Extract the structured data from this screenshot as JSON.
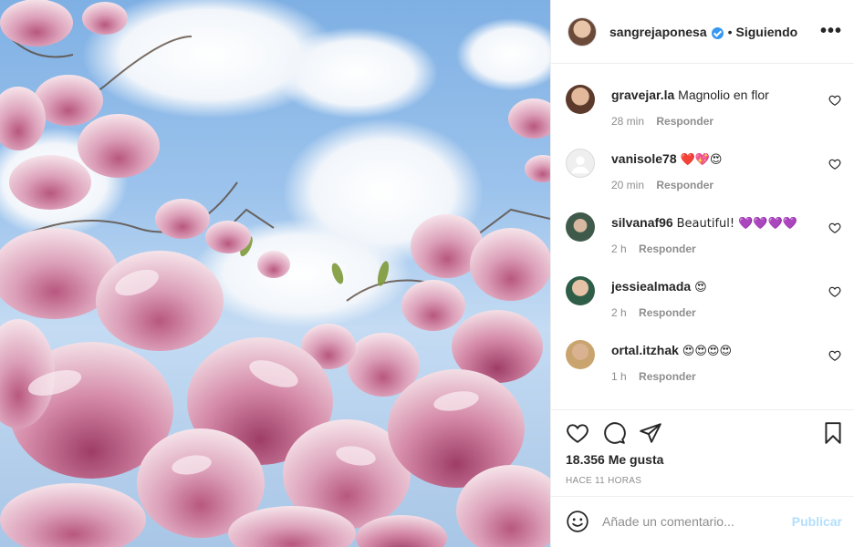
{
  "post": {
    "owner": "sangrejaponesa",
    "follow_status": "Siguiendo",
    "separator": "•",
    "more_label": "•••"
  },
  "comments": [
    {
      "user": "gravejar.la",
      "text": "Magnolio en flor",
      "time": "28 min",
      "reply": "Responder"
    },
    {
      "user": "vanisole78",
      "text": "❤️💖😍",
      "time": "20 min",
      "reply": "Responder"
    },
    {
      "user": "silvanaf96",
      "text": "Beautiful! 💜💜💜💜",
      "time": "2 h",
      "reply": "Responder"
    },
    {
      "user": "jessiealmada",
      "text": "😍",
      "time": "2 h",
      "reply": "Responder"
    },
    {
      "user": "ortal.itzhak",
      "text": "😍😍😍😍",
      "time": "1 h",
      "reply": "Responder"
    }
  ],
  "stats": {
    "likes": "18.356 Me gusta",
    "posted": "HACE 11 HORAS"
  },
  "composer": {
    "placeholder": "Añade un comentario...",
    "post_label": "Publicar"
  },
  "colors": {
    "verified": "#3897f0",
    "publish_disabled": "#b2dffc",
    "meta_gray": "#8e8e8e"
  },
  "icons": {
    "like": "heart-icon",
    "comment": "comment-icon",
    "share": "paper-plane-icon",
    "save": "bookmark-icon",
    "emoji": "smiley-icon"
  }
}
